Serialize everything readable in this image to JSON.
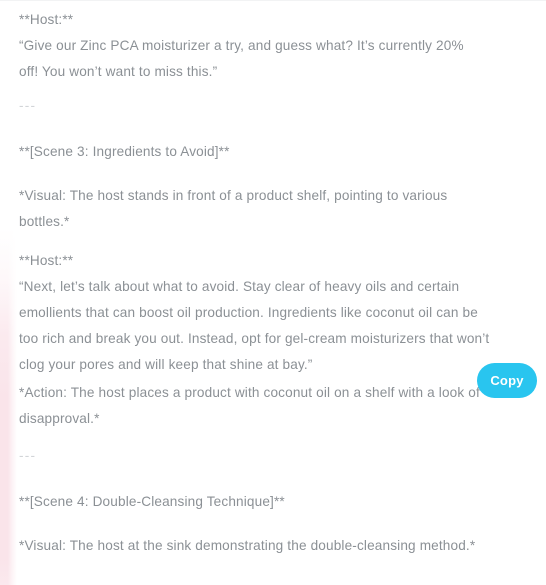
{
  "panel": {
    "background_color": "#ffffff",
    "text_color": "#8b9095",
    "accent_band_color": "#fae4ea",
    "rule_color": "#d2d5d8"
  },
  "copy_button": {
    "label": "Copy",
    "background_color": "#29c5ef",
    "text_color": "#ffffff"
  },
  "transcript": {
    "blocks": [
      {
        "id": "host-label-1",
        "type": "speaker",
        "text": "**Host:**"
      },
      {
        "id": "host-quote-1",
        "type": "paragraph",
        "text": "“Give our Zinc PCA moisturizer a try, and guess what? It’s currently 20% off! You won’t want to miss this.”"
      },
      {
        "id": "divider-1",
        "type": "rule",
        "text": "---"
      },
      {
        "id": "scene-3-heading",
        "type": "heading",
        "text": "**[Scene 3: Ingredients to Avoid]**"
      },
      {
        "id": "scene-3-visual",
        "type": "paragraph",
        "text": "*Visual: The host stands in front of a product shelf, pointing to various bottles.*"
      },
      {
        "id": "host-label-2",
        "type": "speaker",
        "text": "**Host:**"
      },
      {
        "id": "host-quote-2",
        "type": "paragraph",
        "text": "“Next, let’s talk about what to avoid. Stay clear of heavy oils and certain emollients that can boost oil production. Ingredients like coconut oil can be too rich and break you out. Instead, opt for gel-cream moisturizers that won’t clog your pores and will keep that shine at bay.”"
      },
      {
        "id": "scene-3-action",
        "type": "paragraph",
        "text": "*Action: The host places a product with coconut oil on a shelf with a look of disapproval.*"
      },
      {
        "id": "divider-2",
        "type": "rule",
        "text": "---"
      },
      {
        "id": "scene-4-heading",
        "type": "heading",
        "text": "**[Scene 4: Double-Cleansing Technique]**"
      },
      {
        "id": "scene-4-visual",
        "type": "paragraph",
        "text": "*Visual: The host at the sink demonstrating the double-cleansing method.*"
      }
    ]
  }
}
